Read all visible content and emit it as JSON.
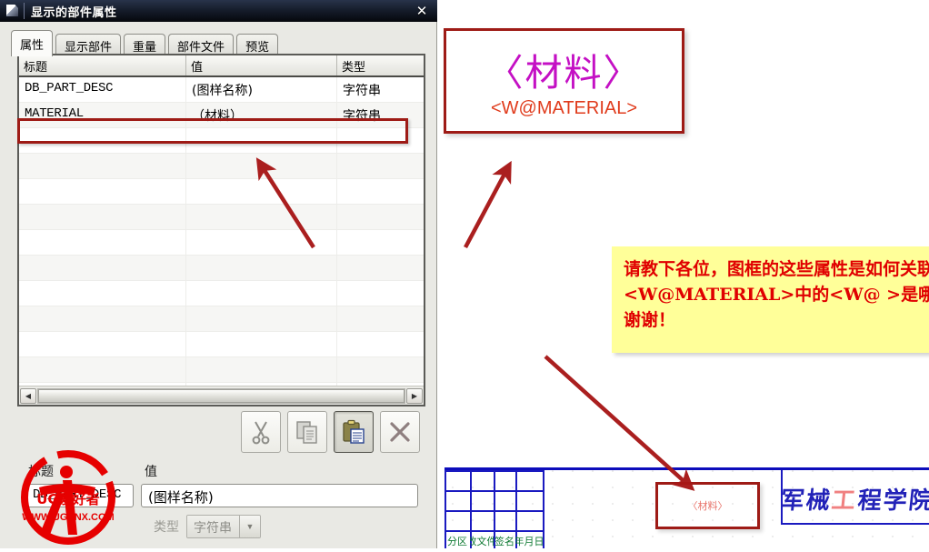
{
  "window": {
    "title": "显示的部件属性",
    "icon": "window-icon",
    "close_label": "✕"
  },
  "tabs": [
    {
      "label": "属性",
      "active": true
    },
    {
      "label": "显示部件",
      "active": false
    },
    {
      "label": "重量",
      "active": false
    },
    {
      "label": "部件文件",
      "active": false
    },
    {
      "label": "预览",
      "active": false
    }
  ],
  "property_list": {
    "columns": [
      "标题",
      "值",
      "类型"
    ],
    "rows": [
      {
        "title": "DB_PART_DESC",
        "value": "(图样名称)",
        "type": "字符串",
        "selected": false
      },
      {
        "title": "MATERIAL",
        "value": "（材料）",
        "type": "字符串",
        "selected": true
      }
    ],
    "empty_row_count": 10,
    "scroll_left_arrow": "◀",
    "scroll_right_arrow": "▶"
  },
  "toolbar": {
    "cut_label": "cut-icon",
    "copy_label": "copy-icon",
    "paste_label": "paste-icon",
    "delete_label": "delete-icon"
  },
  "editor": {
    "title_label": "标题",
    "value_label": "值",
    "title_value": "DB_PART_DESC",
    "value_value": "(图样名称)",
    "type_label": "类型",
    "type_value": "字符串",
    "type_arrow": "▼"
  },
  "watermark": {
    "brand": "UG爱好者",
    "site": "WWW.UGSNX.COM"
  },
  "material_box": {
    "cjk_text": "〈材料〉",
    "tag_text": "<W@MATERIAL>"
  },
  "note": {
    "line1": "请教下各位，图框的这些属性是如何关联的？",
    "line2": "<W@MATERIAL>中的<W@  >是哪里的符号？",
    "line3": "谢谢！"
  },
  "cad_block": {
    "column_labels": [
      "分区",
      "更改文件号",
      "签名",
      "年月日"
    ],
    "material_cell": "〈材料〉",
    "logo_chars": [
      "军",
      "械",
      "工",
      "程",
      "学",
      "院"
    ],
    "logo_accent_index": 2
  },
  "colors": {
    "accent_red": "#9e1b16",
    "arrow_red": "#a81818",
    "note_bg": "#ffff99",
    "note_text": "#e00000",
    "material_magenta": "#c410c4",
    "material_tag": "#e03b1c",
    "cad_blue": "#1a1ac0",
    "cad_green": "#0f7a33",
    "titlebar_dark": "#0d1322"
  }
}
